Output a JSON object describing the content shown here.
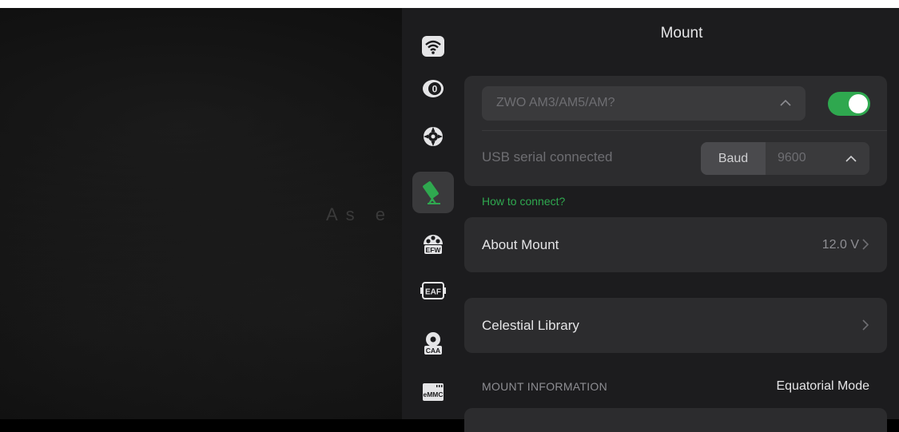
{
  "background": {
    "title": "As  e"
  },
  "header": {
    "title": "Mount"
  },
  "rail": {
    "items": [
      {
        "icon": "wifi-icon"
      },
      {
        "icon": "camera-zero-icon"
      },
      {
        "icon": "guide-crosshair-icon"
      },
      {
        "icon": "telescope-mount-icon",
        "active": true
      },
      {
        "icon": "efw-icon",
        "label": "EFW"
      },
      {
        "icon": "eaf-icon",
        "label": "EAF"
      },
      {
        "icon": "caa-icon",
        "label": "CAA"
      },
      {
        "icon": "emmc-icon",
        "label": "eMMC"
      }
    ]
  },
  "mount": {
    "model_placeholder": "ZWO AM3/AM5/AM?",
    "enabled": true,
    "usb_status": "USB serial connected",
    "baud_label": "Baud",
    "baud_value": "9600",
    "how_to_connect": "How to connect?"
  },
  "about": {
    "label": "About Mount",
    "value": "12.0 V"
  },
  "library": {
    "label": "Celestial Library"
  },
  "info": {
    "section": "MOUNT INFORMATION",
    "mode": "Equatorial Mode"
  },
  "colors": {
    "accent": "#2fa84f",
    "panel": "#1c1c1e",
    "card": "#2c2c2e"
  }
}
